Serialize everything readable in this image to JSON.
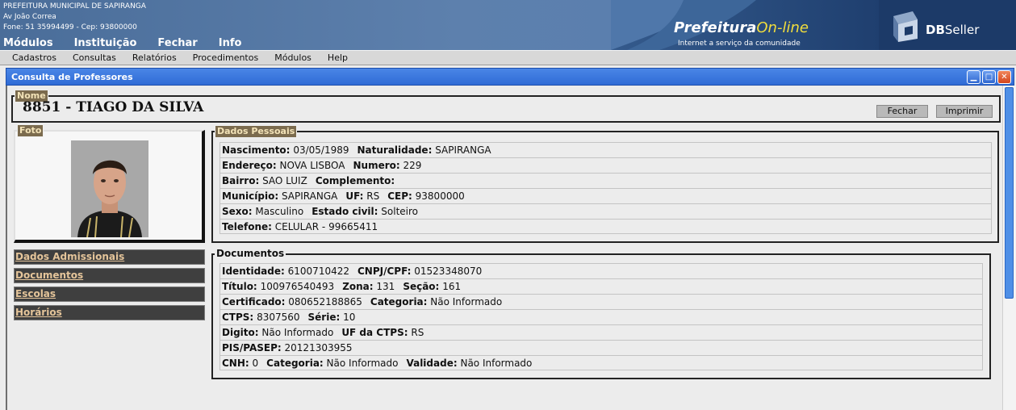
{
  "header": {
    "org_name": "PREFEITURA MUNICIPAL DE SAPIRANGA",
    "address": "Av João Correa",
    "contact": "Fone: 51 35994499  -  Cep: 93800000",
    "top_menu": [
      "Módulos",
      "Instituição",
      "Fechar",
      "Info"
    ],
    "logo_prefeitura_part1": "Prefeitura",
    "logo_prefeitura_part2": "On-line",
    "logo_tagline": "Internet a serviço da comunidade",
    "logo_db": "DB",
    "logo_seller": "Seller"
  },
  "menubar": [
    "Cadastros",
    "Consultas",
    "Relatórios",
    "Procedimentos",
    "Módulos",
    "Help"
  ],
  "window": {
    "title": "Consulta de Professores",
    "min_glyph": "▁",
    "max_glyph": "□",
    "close_glyph": "✕"
  },
  "nome": {
    "legend": "Nome",
    "value": "8851  -  TIAGO DA SILVA",
    "fechar_label": "Fechar",
    "imprimir_label": "Imprimir"
  },
  "foto": {
    "legend": "Foto"
  },
  "nav": [
    "Dados Admissionais",
    "Documentos",
    "Escolas",
    "Horários"
  ],
  "dados_pessoais": {
    "legend": "Dados Pessoais",
    "nascimento_label": "Nascimento:",
    "nascimento": "03/05/1989",
    "naturalidade_label": "Naturalidade:",
    "naturalidade": "SAPIRANGA",
    "endereco_label": "Endereço:",
    "endereco": "NOVA LISBOA",
    "numero_label": "Numero:",
    "numero": "229",
    "bairro_label": "Bairro:",
    "bairro": "SAO LUIZ",
    "complemento_label": "Complemento:",
    "complemento": "",
    "municipio_label": "Município:",
    "municipio": "SAPIRANGA",
    "uf_label": "UF:",
    "uf": "RS",
    "cep_label": "CEP:",
    "cep": "93800000",
    "sexo_label": "Sexo:",
    "sexo": "Masculino",
    "estado_civil_label": "Estado civil:",
    "estado_civil": "Solteiro",
    "telefone_label": "Telefone:",
    "telefone": "CELULAR - 99665411"
  },
  "documentos": {
    "legend": "Documentos",
    "identidade_label": "Identidade:",
    "identidade": "6100710422",
    "cnpj_label": "CNPJ/CPF:",
    "cnpj": "01523348070",
    "titulo_label": "Título:",
    "titulo": "100976540493",
    "zona_label": "Zona:",
    "zona": "131",
    "secao_label": "Seção:",
    "secao": "161",
    "certificado_label": "Certificado:",
    "certificado": "080652188865",
    "categoria_label": "Categoria:",
    "categoria": "Não Informado",
    "ctps_label": "CTPS:",
    "ctps": "8307560",
    "serie_label": "Série:",
    "serie": "10",
    "digito_label": "Digito:",
    "digito": "Não Informado",
    "uf_ctps_label": "UF da CTPS:",
    "uf_ctps": "RS",
    "pis_label": "PIS/PASEP:",
    "pis": "20121303955",
    "cnh_label": "CNH:",
    "cnh": "0",
    "cnh_categoria_label": "Categoria:",
    "cnh_categoria": "Não Informado",
    "validade_label": "Validade:",
    "validade": "Não Informado"
  }
}
